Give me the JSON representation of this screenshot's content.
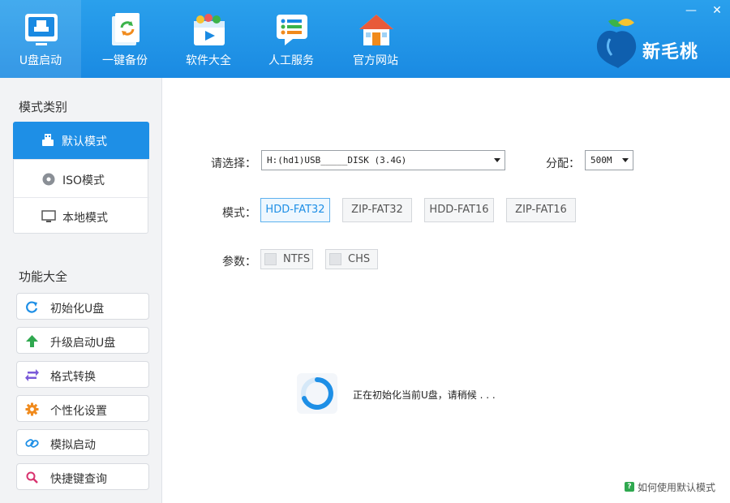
{
  "window": {
    "minimize_glyph": "—",
    "close_glyph": "✕"
  },
  "nav": {
    "tabs": [
      {
        "label": "U盘启动",
        "icon": "usb-boot-icon"
      },
      {
        "label": "一键备份",
        "icon": "backup-icon"
      },
      {
        "label": "软件大全",
        "icon": "software-icon"
      },
      {
        "label": "人工服务",
        "icon": "chat-service-icon"
      },
      {
        "label": "官方网站",
        "icon": "home-icon"
      }
    ],
    "active_index": 0
  },
  "brand": {
    "name": "新毛桃",
    "logo_icon": "peach-logo-icon"
  },
  "sidebar": {
    "mode_title": "模式类别",
    "modes": [
      {
        "label": "默认模式",
        "icon": "usb-drive-icon",
        "active": true
      },
      {
        "label": "ISO模式",
        "icon": "disc-icon",
        "active": false
      },
      {
        "label": "本地模式",
        "icon": "monitor-icon",
        "active": false
      }
    ],
    "function_title": "功能大全",
    "functions": [
      {
        "label": "初始化U盘",
        "icon": "refresh-icon"
      },
      {
        "label": "升级启动U盘",
        "icon": "upgrade-arrow-icon"
      },
      {
        "label": "格式转换",
        "icon": "swap-icon"
      },
      {
        "label": "个性化设置",
        "icon": "gear-icon"
      },
      {
        "label": "模拟启动",
        "icon": "link-icon"
      },
      {
        "label": "快捷键查询",
        "icon": "search-icon"
      }
    ]
  },
  "main": {
    "select_label": "请选择：",
    "disk_value": "H:(hd1)USB_____DISK (3.4G)",
    "alloc_label": "分配：",
    "alloc_value": "500M",
    "mode_label": "模式：",
    "mode_options": [
      "HDD-FAT32",
      "ZIP-FAT32",
      "HDD-FAT16",
      "ZIP-FAT16"
    ],
    "mode_selected": "HDD-FAT32",
    "param_label": "参数：",
    "params": [
      {
        "label": "NTFS",
        "checked": false
      },
      {
        "label": "CHS",
        "checked": false
      }
    ],
    "status_text": "正在初始化当前U盘，请稍候 . . .",
    "help_icon": "?",
    "help_link": "如何使用默认模式"
  },
  "colors": {
    "header_blue": "#1a8ae2",
    "active_blue": "#1e8fe6",
    "sidebar_bg": "#f2f3f5"
  }
}
